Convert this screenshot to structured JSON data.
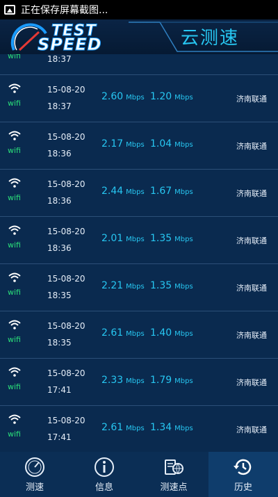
{
  "status_bar": {
    "text": "正在保存屏幕截图..."
  },
  "header": {
    "logo_top": "TEST",
    "logo_bottom": "SPEED",
    "title": "云测速"
  },
  "partial_row": {
    "net": "wifi",
    "time": "18:37"
  },
  "units": "Mbps",
  "rows": [
    {
      "net": "wifi",
      "date": "15-08-20",
      "time": "18:37",
      "down": "2.60",
      "up": "1.20",
      "isp": "济南联通"
    },
    {
      "net": "wifi",
      "date": "15-08-20",
      "time": "18:36",
      "down": "2.17",
      "up": "1.04",
      "isp": "济南联通"
    },
    {
      "net": "wifi",
      "date": "15-08-20",
      "time": "18:36",
      "down": "2.44",
      "up": "1.67",
      "isp": "济南联通"
    },
    {
      "net": "wifi",
      "date": "15-08-20",
      "time": "18:36",
      "down": "2.01",
      "up": "1.35",
      "isp": "济南联通"
    },
    {
      "net": "wifi",
      "date": "15-08-20",
      "time": "18:35",
      "down": "2.21",
      "up": "1.35",
      "isp": "济南联通"
    },
    {
      "net": "wifi",
      "date": "15-08-20",
      "time": "18:35",
      "down": "2.61",
      "up": "1.40",
      "isp": "济南联通"
    },
    {
      "net": "wifi",
      "date": "15-08-20",
      "time": "17:41",
      "down": "2.33",
      "up": "1.79",
      "isp": "济南联通"
    },
    {
      "net": "wifi",
      "date": "15-08-20",
      "time": "17:41",
      "down": "2.61",
      "up": "1.34",
      "isp": "济南联通"
    }
  ],
  "tabs": [
    {
      "label": "测速",
      "icon": "speedometer-icon",
      "active": false
    },
    {
      "label": "信息",
      "icon": "info-icon",
      "active": false
    },
    {
      "label": "测速点",
      "icon": "server-globe-icon",
      "active": false
    },
    {
      "label": "历史",
      "icon": "history-icon",
      "active": true
    }
  ],
  "colors": {
    "background": "#0a2a4f",
    "accent": "#27c7f2",
    "wifi_text": "#2be07a"
  }
}
